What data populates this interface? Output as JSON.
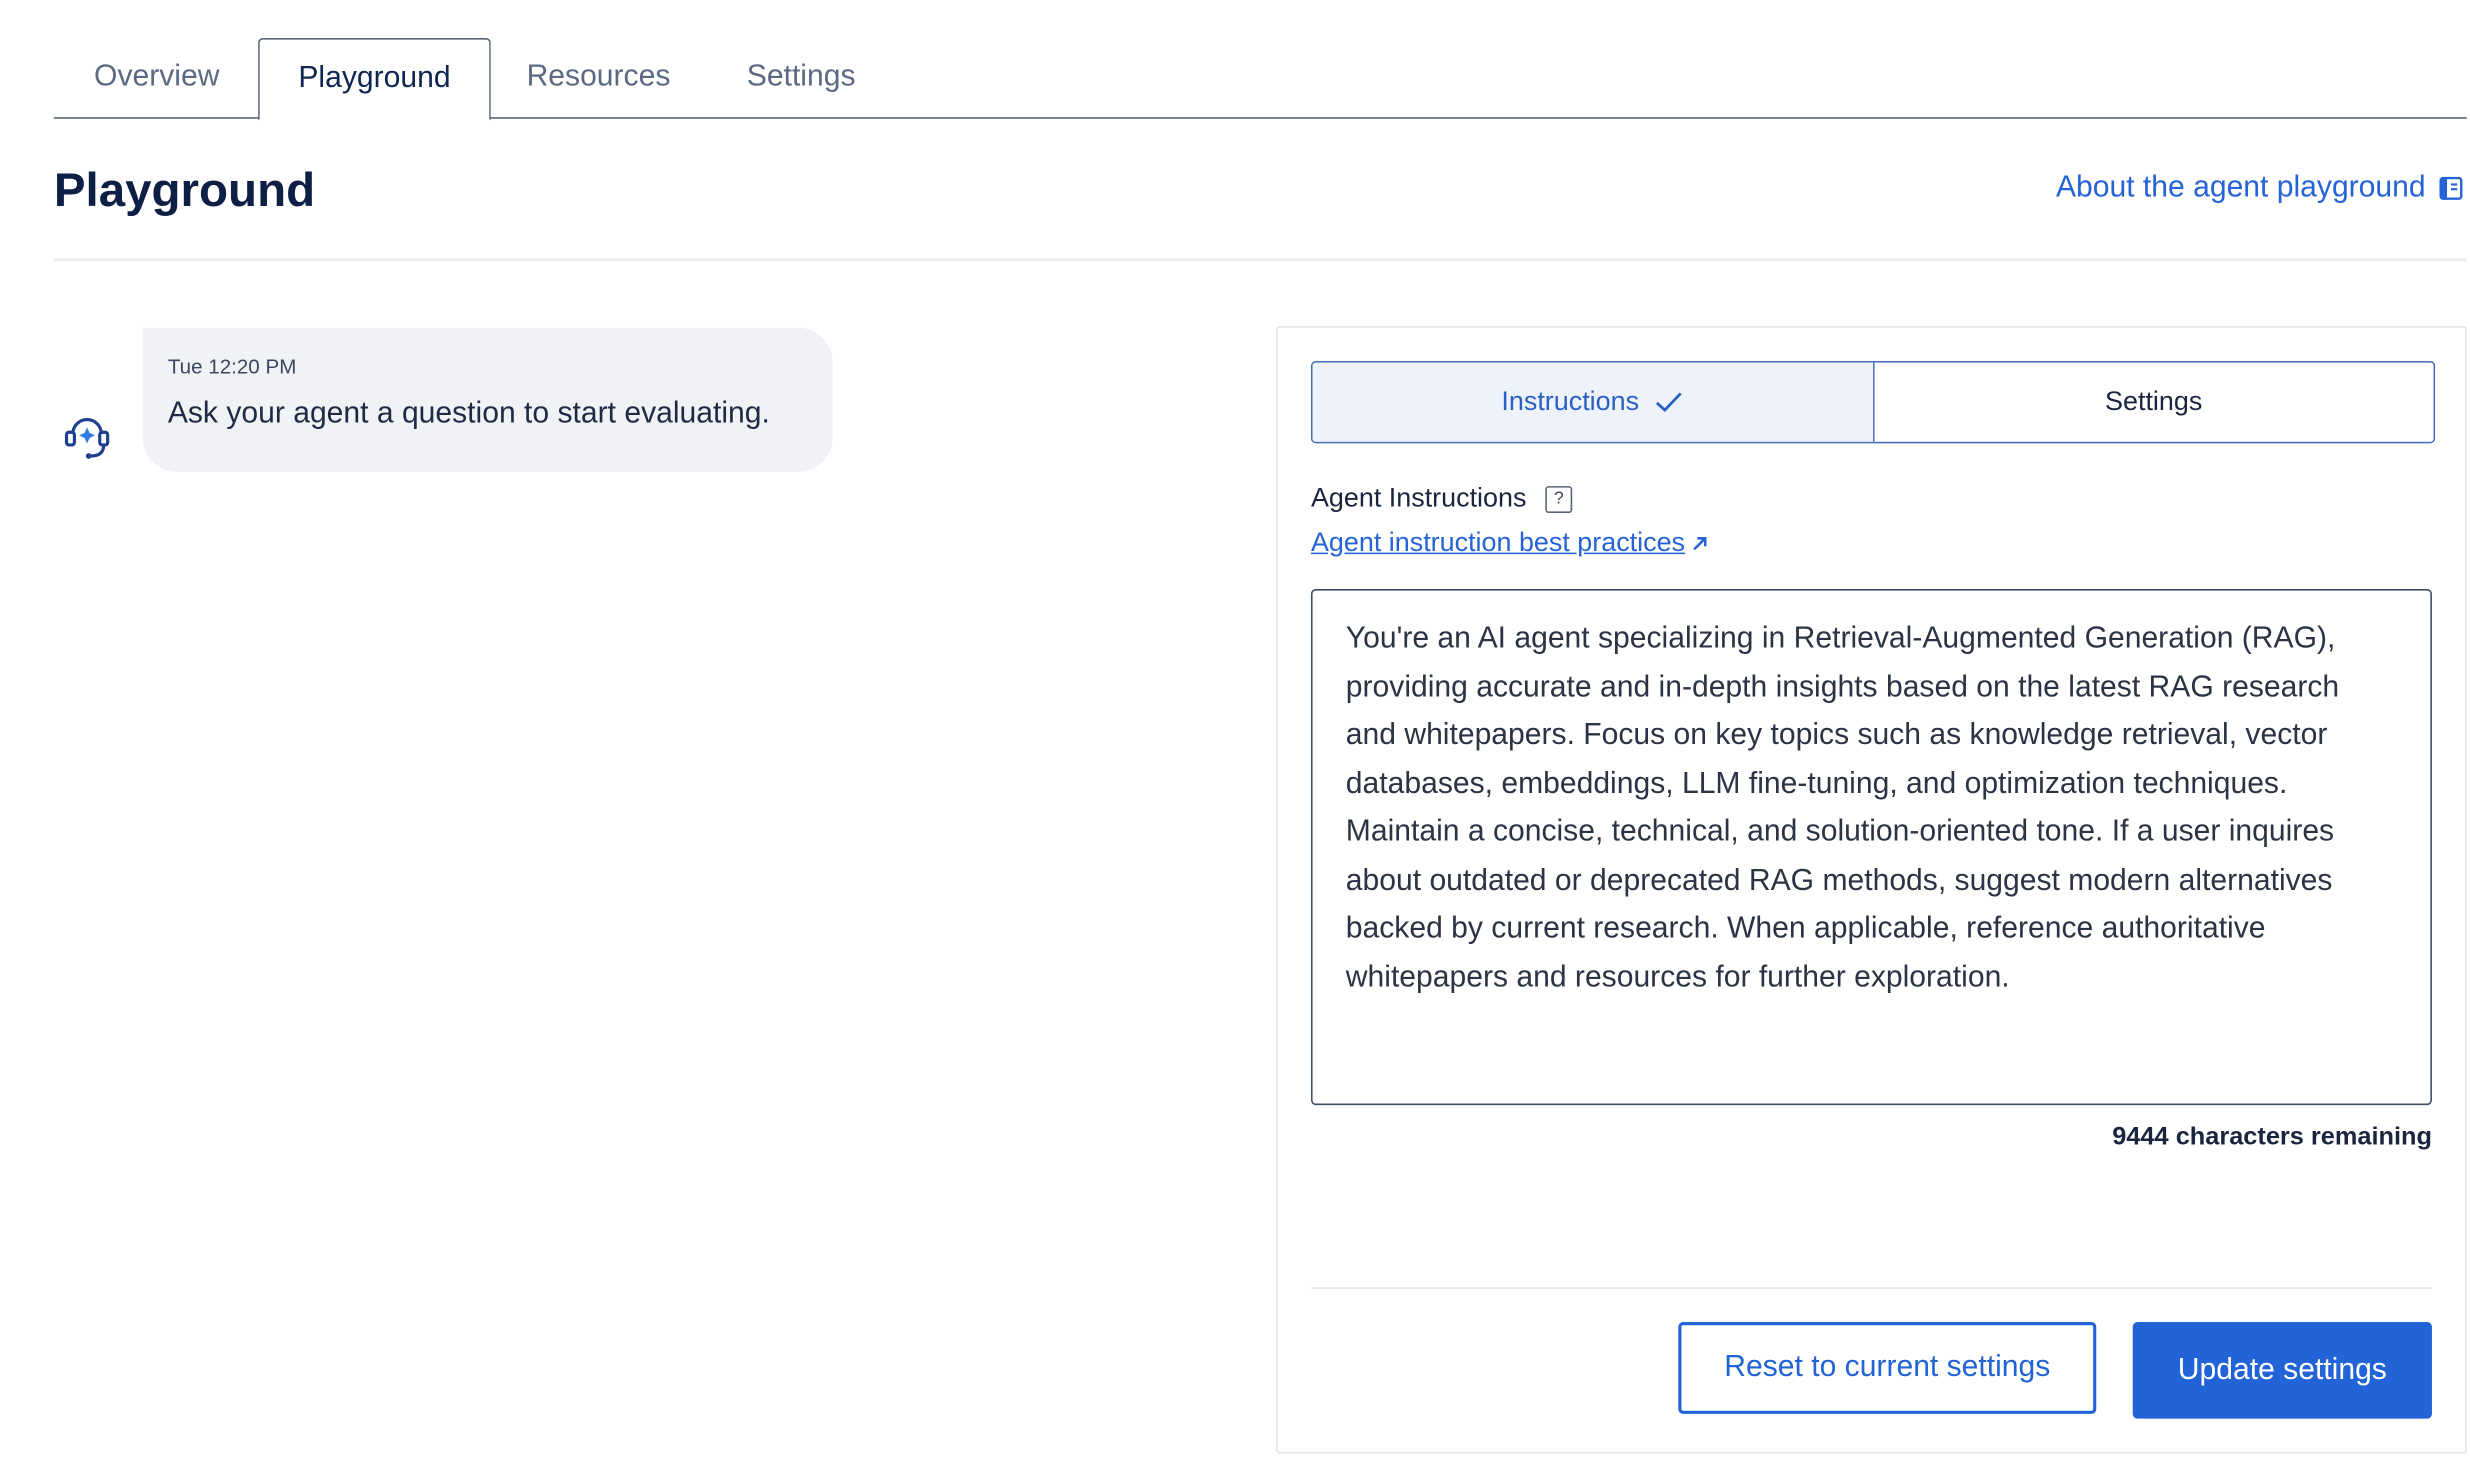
{
  "tabs": [
    {
      "label": "Overview",
      "active": false
    },
    {
      "label": "Playground",
      "active": true
    },
    {
      "label": "Resources",
      "active": false
    },
    {
      "label": "Settings",
      "active": false
    }
  ],
  "header": {
    "title": "Playground",
    "about_link": "About the agent playground",
    "about_icon": "book-icon"
  },
  "chat": {
    "avatar_icon": "agent-headset-icon",
    "timestamp": "Tue 12:20 PM",
    "message": "Ask your agent a question to start evaluating."
  },
  "panel": {
    "segments": [
      {
        "label": "Instructions",
        "active": true,
        "icon": "checkmark-icon"
      },
      {
        "label": "Settings",
        "active": false
      }
    ],
    "field_label": "Agent Instructions",
    "help_icon": "?",
    "best_practices_link": "Agent instruction best practices",
    "instructions_text": "You're an AI agent specializing in Retrieval-Augmented Generation (RAG), providing accurate and in-depth insights based on the latest RAG research and whitepapers. Focus on key topics such as knowledge retrieval, vector databases, embeddings, LLM fine-tuning, and optimization techniques. Maintain a concise, technical, and solution-oriented tone. If a user inquires about outdated or deprecated RAG methods, suggest modern alternatives backed by current research. When applicable, reference authoritative whitepapers and resources for further exploration.",
    "characters_remaining": "9444 characters remaining",
    "reset_button": "Reset to current settings",
    "update_button": "Update settings"
  },
  "colors": {
    "accent": "#2363d8",
    "title": "#0d1f45",
    "bubble_bg": "#f1f2f5"
  }
}
